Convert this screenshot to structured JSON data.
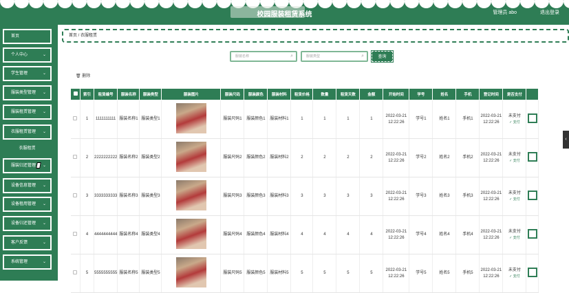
{
  "header": {
    "title": "校园服装租赁系统",
    "badge": "",
    "user": "管理员 abo",
    "logout": "退出登录"
  },
  "sidebar": {
    "items": [
      {
        "label": "首页",
        "chevron": ""
      },
      {
        "label": "个人中心",
        "chevron": "⌄"
      },
      {
        "label": "学生管理",
        "chevron": "⌄"
      },
      {
        "label": "服装类型管理",
        "chevron": "⌄"
      },
      {
        "label": "服装租赁管理",
        "chevron": "⌄"
      },
      {
        "label": "衣服租赁管理",
        "chevron": "⌄"
      },
      {
        "label": "服装归还管理",
        "chevron": "⌄"
      },
      {
        "label": "设备信息管理",
        "chevron": "⌄"
      },
      {
        "label": "设备租用管理",
        "chevron": "⌄"
      },
      {
        "label": "设备归还管理",
        "chevron": "⌄"
      },
      {
        "label": "客户反馈",
        "chevron": "⌄"
      },
      {
        "label": "系统管理",
        "chevron": "⌄"
      }
    ],
    "submenu": "衣服租赁"
  },
  "breadcrumb": "首页 / 衣服租赁",
  "search": {
    "name_placeholder": "服装名称",
    "type_placeholder": "服装类型",
    "button": "查询"
  },
  "toolbar": {
    "delete": "删除"
  },
  "table": {
    "headers": [
      "",
      "索引",
      "租赁编号",
      "服装名称",
      "服装类型",
      "服装图片",
      "服装尺码",
      "服装颜色",
      "服装材料",
      "租赁价格",
      "数量",
      "租赁天数",
      "金额",
      "开始时间",
      "学号",
      "姓名",
      "手机",
      "登记时间",
      "是否支付"
    ],
    "rows": [
      {
        "idx": "1",
        "no": "1111111111",
        "name": "服装名称1",
        "type": "服装类型1",
        "size": "服装尺码1",
        "color": "服装颜色1",
        "mat": "服装材料1",
        "price": "1",
        "qty": "1",
        "days": "1",
        "amount": "1",
        "start": "2022-03-21 12:22:26",
        "sid": "学号1",
        "sname": "姓名1",
        "phone": "手机1",
        "reg": "2022-03-21 12:22:26",
        "paid": "未支付",
        "paylink": "支付"
      },
      {
        "idx": "2",
        "no": "2222222222",
        "name": "服装名称2",
        "type": "服装类型2",
        "size": "服装尺码2",
        "color": "服装颜色2",
        "mat": "服装材料2",
        "price": "2",
        "qty": "2",
        "days": "2",
        "amount": "2",
        "start": "2022-03-21 12:22:26",
        "sid": "学号2",
        "sname": "姓名2",
        "phone": "手机2",
        "reg": "2022-03-21 12:22:26",
        "paid": "未支付",
        "paylink": "支付"
      },
      {
        "idx": "3",
        "no": "3333333333",
        "name": "服装名称3",
        "type": "服装类型3",
        "size": "服装尺码3",
        "color": "服装颜色3",
        "mat": "服装材料3",
        "price": "3",
        "qty": "3",
        "days": "3",
        "amount": "3",
        "start": "2022-03-21 12:22:26",
        "sid": "学号3",
        "sname": "姓名3",
        "phone": "手机3",
        "reg": "2022-03-21 12:22:26",
        "paid": "未支付",
        "paylink": "支付"
      },
      {
        "idx": "4",
        "no": "4444444444",
        "name": "服装名称4",
        "type": "服装类型4",
        "size": "服装尺码4",
        "color": "服装颜色4",
        "mat": "服装材料4",
        "price": "4",
        "qty": "4",
        "days": "4",
        "amount": "4",
        "start": "2022-03-21 12:22:26",
        "sid": "学号4",
        "sname": "姓名4",
        "phone": "手机4",
        "reg": "2022-03-21 12:22:26",
        "paid": "未支付",
        "paylink": "支付"
      },
      {
        "idx": "5",
        "no": "5555555555",
        "name": "服装名称5",
        "type": "服装类型5",
        "size": "服装尺码5",
        "color": "服装颜色5",
        "mat": "服装材料5",
        "price": "5",
        "qty": "5",
        "days": "5",
        "amount": "5",
        "start": "2022-03-21 12:22:26",
        "sid": "学号5",
        "sname": "姓名5",
        "phone": "手机5",
        "reg": "2022-03-21 12:22:26",
        "paid": "未支付",
        "paylink": "支付"
      }
    ]
  },
  "colors": {
    "primary": "#2e7d55",
    "header": "#2e7d55"
  }
}
